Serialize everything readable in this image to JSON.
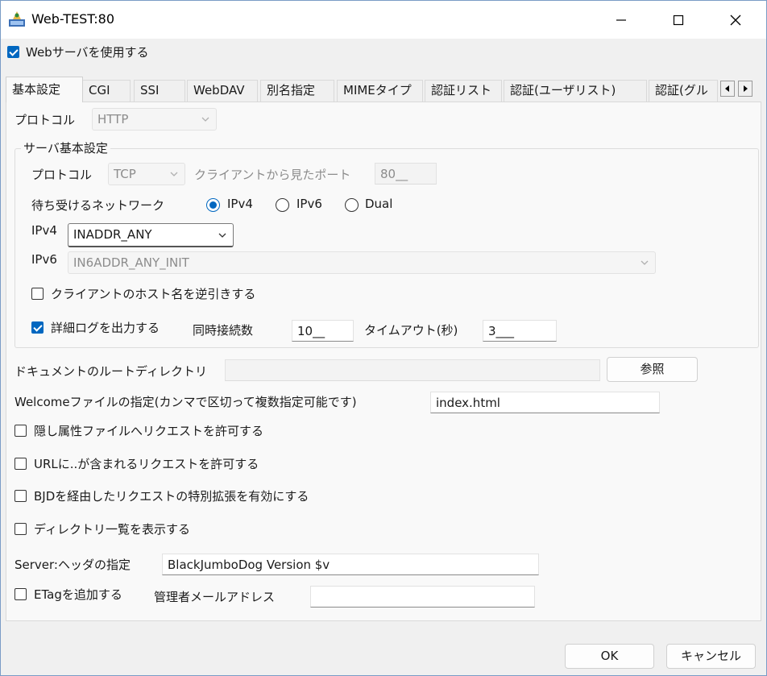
{
  "window": {
    "title": "Web-TEST:80"
  },
  "use_webserver": {
    "label": "Webサーバを使用する",
    "checked": true
  },
  "tabs": [
    "基本設定",
    "CGI",
    "SSI",
    "WebDAV",
    "別名指定",
    "MIMEタイプ",
    "認証リスト",
    "認証(ユーザリスト)",
    "認証(グル"
  ],
  "protocol": {
    "label": "プロトコル",
    "value": "HTTP"
  },
  "server_group": {
    "title": "サーバ基本設定",
    "protocol_label": "プロトコル",
    "protocol_value": "TCP",
    "client_port_label": "クライアントから見たポート",
    "client_port_value": "80__",
    "network_label": "待ち受けるネットワーク",
    "radio_ipv4": "IPv4",
    "radio_ipv6": "IPv6",
    "radio_dual": "Dual",
    "selected_network": "IPv4",
    "ipv4_label": "IPv4",
    "ipv4_value": "INADDR_ANY",
    "ipv6_label": "IPv6",
    "ipv6_value": "IN6ADDR_ANY_INIT",
    "reverse_lookup_label": "クライアントのホスト名を逆引きする",
    "reverse_lookup_checked": false,
    "detail_log_label": "詳細ログを出力する",
    "detail_log_checked": true,
    "concurrent_label": "同時接続数",
    "concurrent_value": "10__",
    "timeout_label": "タイムアウト(秒)",
    "timeout_value": "3___"
  },
  "docroot": {
    "label": "ドキュメントのルートディレクトリ",
    "value": "",
    "browse_label": "参照"
  },
  "welcome": {
    "label": "Welcomeファイルの指定(カンマで区切って複数指定可能です)",
    "value": "index.html"
  },
  "options": [
    {
      "label": "隠し属性ファイルへリクエストを許可する",
      "checked": false
    },
    {
      "label": "URLに..が含まれるリクエストを許可する",
      "checked": false
    },
    {
      "label": "BJDを経由したリクエストの特別拡張を有効にする",
      "checked": false
    },
    {
      "label": "ディレクトリ一覧を表示する",
      "checked": false
    }
  ],
  "server_header": {
    "label": "Server:ヘッダの指定",
    "value": "BlackJumboDog Version $v"
  },
  "etag": {
    "label": "ETagを追加する",
    "checked": false
  },
  "admin_mail": {
    "label": "管理者メールアドレス",
    "value": ""
  },
  "buttons": {
    "ok": "OK",
    "cancel": "キャンセル"
  },
  "colors": {
    "accent": "#0067c0",
    "window_bg": "#f0f0f0",
    "panel_bg": "#f9f9f9"
  },
  "icons": [
    "app-icon",
    "minimize-icon",
    "maximize-icon",
    "close-icon",
    "chevron-down-icon",
    "tab-scroll-left-icon",
    "tab-scroll-right-icon"
  ]
}
